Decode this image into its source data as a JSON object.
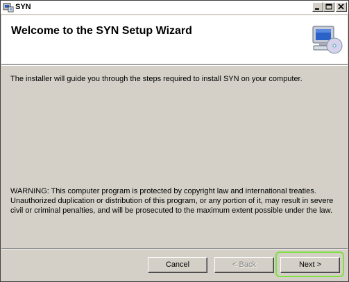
{
  "window": {
    "title": "SYN",
    "controls": {
      "minimize": "minimize-icon",
      "maximize": "maximize-icon",
      "close": "close-icon"
    }
  },
  "header": {
    "title": "Welcome to the SYN Setup Wizard",
    "icon": "computer-cd-icon"
  },
  "body": {
    "intro": "The installer will guide you through the steps required to install SYN on your computer.",
    "warning": "WARNING: This computer program is protected by copyright law and international treaties. Unauthorized duplication or distribution of this program, or any portion of it, may result in severe civil or criminal penalties, and will be prosecuted to the maximum extent possible under the law."
  },
  "buttons": {
    "cancel": "Cancel",
    "back": "< Back",
    "next": "Next >"
  },
  "colors": {
    "highlight": "#7fe040",
    "face": "#d4d0c8"
  }
}
